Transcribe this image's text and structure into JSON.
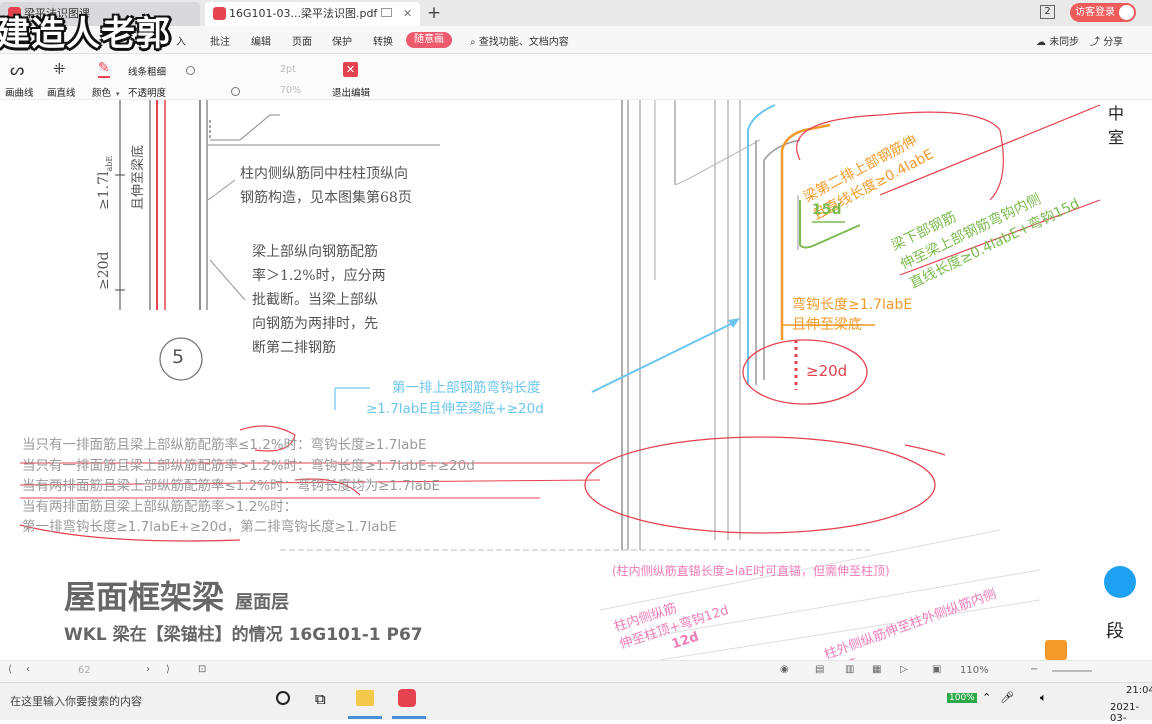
{
  "titlebar": {
    "tab1_label": "梁平法识图课",
    "tab2_label": "16G101-03...梁平法识图.pdf",
    "new_tab": "+",
    "window_count": "2",
    "login_label": "访客登录"
  },
  "watermark": "建造人老郭",
  "menubar": {
    "items": [
      "入",
      "批注",
      "编辑",
      "页面",
      "保护",
      "转换"
    ],
    "active": "随意画",
    "search": "查找功能、文档内容",
    "sync": "未同步",
    "share": "分享"
  },
  "inkbar": {
    "curve": "画曲线",
    "line": "画直线",
    "color": "颜色",
    "thickness_label": "线条粗细",
    "thickness_value": "2pt",
    "opacity_label": "不透明度",
    "opacity_value": "70%",
    "exit": "退出编辑"
  },
  "drawing": {
    "dim_top": "≥1.7l",
    "dim_top_sub": "abE",
    "dim_top_tail": "且伸至梁底",
    "dim_bottom": "≥20d",
    "note1": [
      "柱内侧纵筋同中柱柱顶纵向",
      "钢筋构造，见本图集第68页"
    ],
    "note2": [
      "梁上部纵向钢筋配筋",
      "率＞1.2%时，应分两",
      "批截断。当梁上部纵",
      "向钢筋为两排时，先",
      "断第二排钢筋"
    ],
    "detail_number": "5",
    "right_edge": [
      "中",
      "室"
    ]
  },
  "annotations": {
    "blue_note": [
      "第一排上部钢筋弯钩长度",
      "≥1.7labE且伸至梁底+≥20d"
    ],
    "orange_top": [
      "梁第二排上部钢筋伸",
      "且直线长度≥0.4labE"
    ],
    "green_15d": "15d",
    "green_note": [
      "梁下部钢筋",
      "伸至梁上部钢筋弯钩内侧",
      "直线长度≥0.4labE+弯钩15d"
    ],
    "orange_hook": [
      "弯钩长度≥1.7labE",
      "且伸至梁底"
    ],
    "red_20d": "≥20d",
    "rules": [
      "当只有一排面筋且梁上部纵筋配筋率≤1.2%时：弯钩长度≥1.7labE",
      "当只有一排面筋且梁上部纵筋配筋率>1.2%时：弯钩长度≥1.7labE+≥20d",
      "当有两排面筋且梁上部纵筋配筋率≤1.2%时：弯钩长度均为≥1.7labE",
      "当有两排面筋且梁上部纵筋配筋率>1.2%时：",
      "第一排弯钩长度≥1.7labE+≥20d，第二排弯钩长度≥1.7labE"
    ],
    "pink_top": "(柱内侧纵筋直锚长度≥laE时可直锚，但需伸至柱顶)",
    "pink_left": [
      "柱内侧纵筋",
      "伸至柱顶+弯钩12d"
    ],
    "pink_12d": "12d",
    "pink_right": [
      "柱外侧纵筋伸至柱外侧纵筋内侧",
      "labE"
    ]
  },
  "caption": {
    "title": "屋面框架梁",
    "title_sub": "屋面层",
    "subtitle": "WKL 梁在【梁锚柱】的情况  16G101-1  P67",
    "right_glyph": "段"
  },
  "statusbar": {
    "page_number": "62",
    "zoom": "110%"
  },
  "taskbar": {
    "search_placeholder": "在这里输入你要搜索的内容",
    "battery": "100%",
    "time": "21:04",
    "date": "2021-03-"
  },
  "colors": {
    "red_ink": "#e5434f",
    "blue_ink": "#6cc5ee",
    "orange_ink": "#f39a2a",
    "green_ink": "#7dbb50",
    "pink_ink": "#f07cb8"
  }
}
